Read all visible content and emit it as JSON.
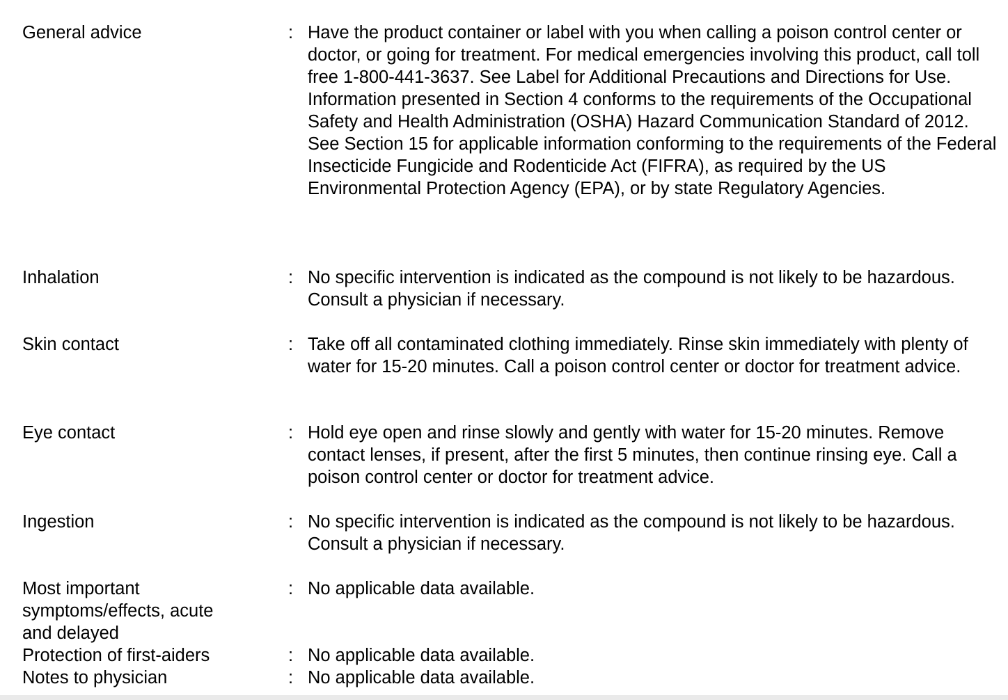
{
  "rows": [
    {
      "label": "General advice",
      "colon": ":",
      "paragraphs": [
        "Have the product container or label with you when calling a poison control center or doctor, or going for treatment. For medical emergencies involving this product, call toll free 1-800-441-3637. See Label for Additional Precautions and Directions for Use.",
        "Information presented in Section 4 conforms to the requirements of the Occupational Safety and Health Administration (OSHA) Hazard Communication Standard of 2012. See Section 15 for applicable information conforming to the requirements of the Federal Insecticide Fungicide and Rodenticide Act (FIFRA), as required by the US Environmental Protection Agency (EPA), or by state Regulatory Agencies."
      ]
    },
    {
      "label": "Inhalation",
      "colon": ":",
      "paragraphs": [
        "No specific intervention is indicated as the compound is not likely to be hazardous. Consult a physician if necessary."
      ]
    },
    {
      "label": "Skin contact",
      "colon": ":",
      "paragraphs": [
        "Take off all contaminated clothing immediately. Rinse skin immediately with plenty of water for 15-20 minutes. Call a poison control center or doctor for treatment advice."
      ]
    },
    {
      "label": "Eye contact",
      "colon": ":",
      "paragraphs": [
        "Hold eye open and rinse slowly and gently with water for 15-20 minutes. Remove contact lenses, if present, after the first 5 minutes, then continue rinsing eye. Call a poison control center or doctor for treatment advice."
      ]
    },
    {
      "label": "Ingestion",
      "colon": ":",
      "paragraphs": [
        "No specific intervention is indicated as the compound is not likely to be hazardous. Consult a physician if necessary."
      ]
    },
    {
      "label": "Most important symptoms/effects, acute and delayed",
      "colon": ":",
      "paragraphs": [
        "No applicable data available."
      ]
    },
    {
      "label": "Protection of first-aiders",
      "colon": ":",
      "paragraphs": [
        "No applicable data available."
      ]
    },
    {
      "label": "Notes to physician",
      "colon": ":",
      "paragraphs": [
        "No applicable data available."
      ]
    }
  ]
}
